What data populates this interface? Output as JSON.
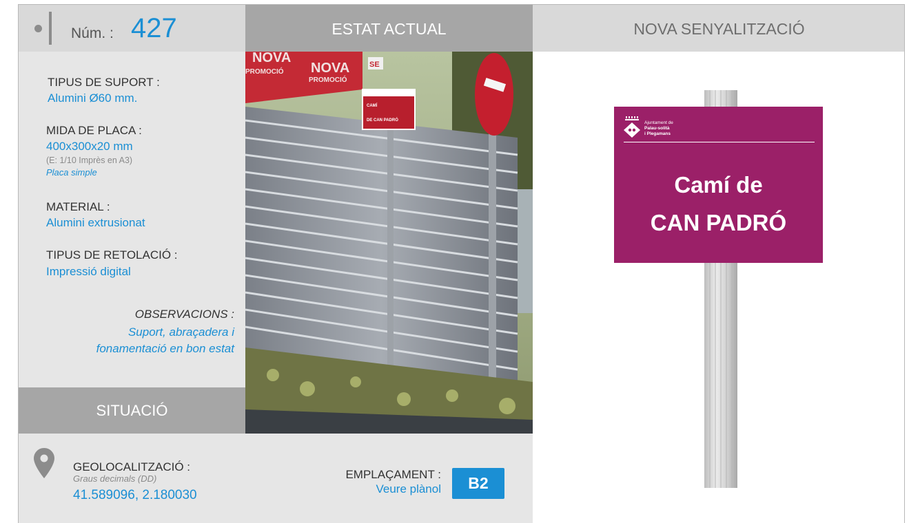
{
  "header": {
    "num_label": "Núm. :",
    "num_value": "427",
    "estat_actual": "ESTAT ACTUAL",
    "nova_senyalitzacio": "NOVA SENYALITZACIÓ"
  },
  "fields": {
    "tipus_suport": {
      "title": "TIPUS DE SUPORT :",
      "value": "Alumini Ø60 mm."
    },
    "mida_placa": {
      "title": "MIDA DE PLACA :",
      "value": "400x300x20 mm",
      "note": "(E: 1/10 Imprès en A3)",
      "type": "Placa simple"
    },
    "material": {
      "title": "MATERIAL :",
      "value": "Alumini extrusionat"
    },
    "retolacio": {
      "title": "TIPUS DE RETOLACIÓ :",
      "value": "Impressió digital"
    },
    "observacions": {
      "title": "OBSERVACIONS :",
      "line1": "Suport, abraçadera i",
      "line2": "fonamentació en bon estat"
    }
  },
  "situacio": {
    "label": "SITUACIÓ"
  },
  "geolocalitzacio": {
    "title": "GEOLOCALITZACIÓ :",
    "note": "Graus decimals (DD)",
    "value": "41.589096, 2.180030"
  },
  "emplacament": {
    "title": "EMPLAÇAMENT :",
    "value": "Veure plànol",
    "badge": "B2"
  },
  "photo_signs": {
    "banner_left": "NOVA",
    "banner_left_sub": "PROMOCIÓ",
    "banner_right": "NOVA",
    "banner_right_sub": "PROMOCIÓ",
    "banner_se": "SE",
    "small_sign_line1": "CAMÍ",
    "small_sign_line2": "DE CAN PADRÓ"
  },
  "new_sign": {
    "logo_line1": "Ajuntament de",
    "logo_line2": "Palau-solità",
    "logo_line3": "i Plegamans",
    "line1": "Camí de",
    "line2": "CAN PADRÓ"
  },
  "colors": {
    "accent_blue": "#1b8fd4",
    "sign_magenta": "#9b2068",
    "panel_grey": "#e6e6e6",
    "header_grey": "#a6a6a6"
  }
}
